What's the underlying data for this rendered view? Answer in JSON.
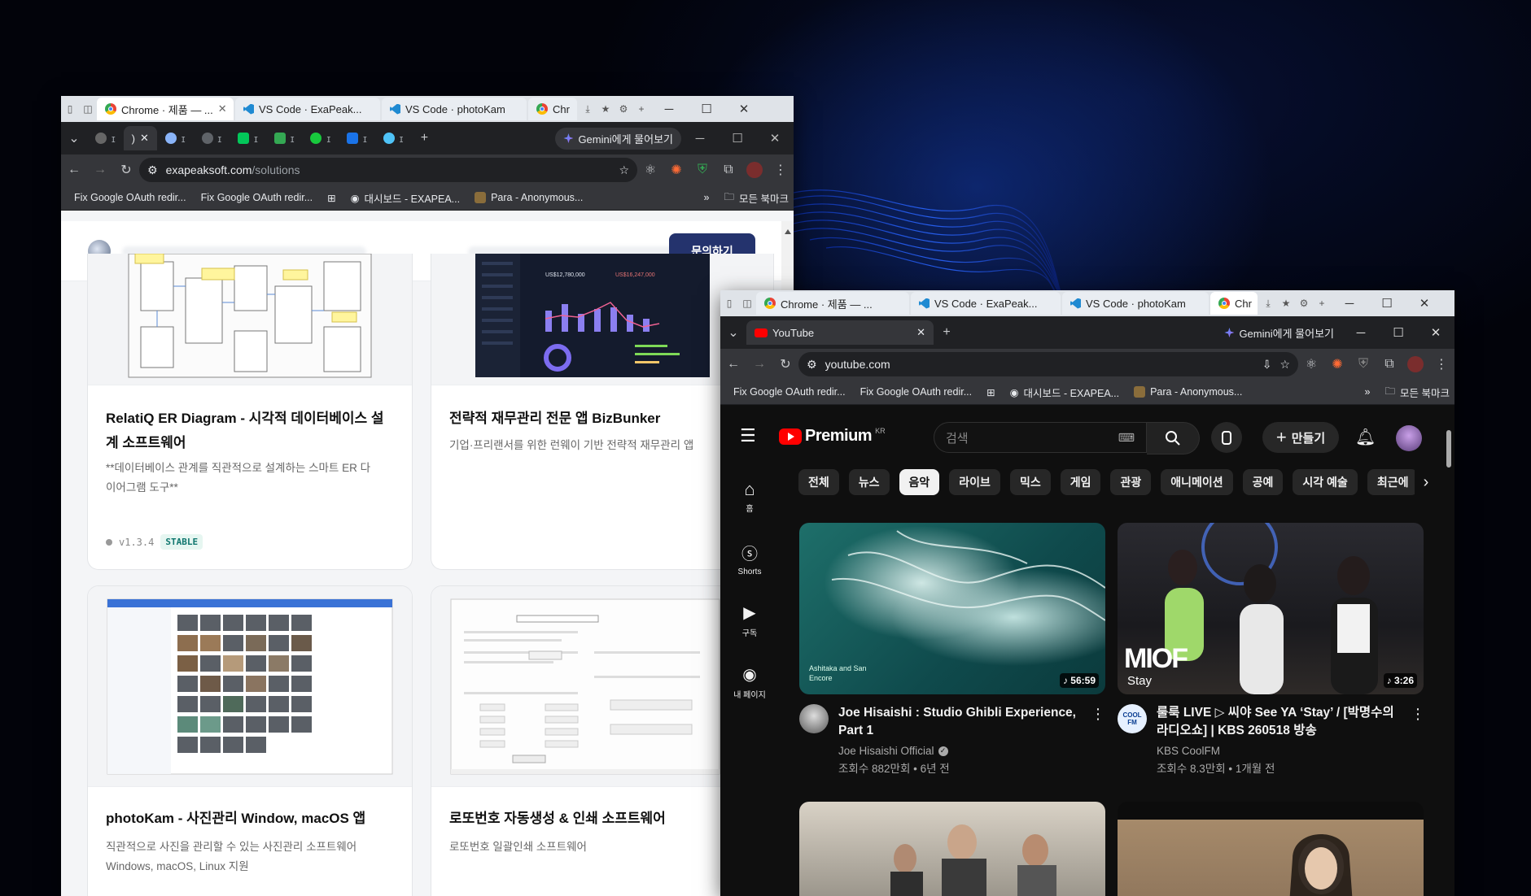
{
  "left_window": {
    "taskbar_tabs": [
      "Chrome · 제품 — ...",
      "VS Code · ExaPeak...",
      "VS Code · photoKam",
      "Chr"
    ],
    "gemini_label": "Gemini에게 물어보기",
    "url_host": "exapeaksoft.com",
    "url_path": "/solutions",
    "bookmarks": [
      "Fix Google OAuth redir...",
      "Fix Google OAuth redir...",
      "대시보드 - EXAPEA...",
      "Para - Anonymous..."
    ],
    "all_bookmarks": "모든 북마크",
    "contact_button": "문의하기",
    "cards": [
      {
        "title": "RelatiQ ER Diagram - 시각적 데이터베이스 설계 소프트웨어",
        "desc": "**데이터베이스 관계를 직관적으로 설계하는 스마트 ER 다이어그램 도구**",
        "version": "v1.3.4",
        "badge": "STABLE"
      },
      {
        "title": "전략적 재무관리 전문 앱 BizBunker",
        "desc": "기업·프리랜서를 위한 런웨이 기반 전략적 재무관리 앱"
      },
      {
        "title": "photoKam - 사진관리 Window, macOS 앱",
        "desc": "직관적으로 사진을 관리할 수 있는 사진관리 소프트웨어",
        "desc2": "Windows, macOS, Linux 지원"
      },
      {
        "title": "로또번호 자동생성 & 인쇄 소프트웨어",
        "desc": "로또번호 일괄인쇄 소프트웨어"
      }
    ],
    "dash_labels": {
      "a": "US$12,780,000",
      "b": "US$16,247,000"
    }
  },
  "right_window": {
    "taskbar_tabs": [
      "Chrome · 제품 — ...",
      "VS Code · ExaPeak...",
      "VS Code · photoKam",
      "Chr"
    ],
    "tab_title": "YouTube",
    "gemini_label": "Gemini에게 물어보기",
    "url": "youtube.com",
    "bookmarks": [
      "Fix Google OAuth redir...",
      "Fix Google OAuth redir...",
      "대시보드 - EXAPEA...",
      "Para - Anonymous..."
    ],
    "all_bookmarks": "모든 북마크",
    "logo_text": "Premium",
    "logo_country": "KR",
    "search_placeholder": "검색",
    "create_label": "만들기",
    "side_nav": [
      "홈",
      "Shorts",
      "구독",
      "내 페이지"
    ],
    "chips": [
      "전체",
      "뉴스",
      "음악",
      "라이브",
      "믹스",
      "게임",
      "관광",
      "애니메이션",
      "공예",
      "시각 예술",
      "최근에"
    ],
    "selected_chip": "음악",
    "videos": [
      {
        "title": "Joe Hisaishi : Studio Ghibli Experience, Part 1",
        "channel": "Joe Hisaishi Official",
        "meta": "조회수 882만회 • 6년 전",
        "duration": "56:59",
        "overlay1": "Ashitaka and San",
        "overlay2": "Encore"
      },
      {
        "title": "룰룩 LIVE ▷ 씨야 See YA ‘Stay’ / [박명수의 라디오쇼] | KBS 260518 방송",
        "channel": "KBS CoolFM",
        "meta": "조회수 8.3만회 • 1개월 전",
        "duration": "3:26",
        "overlay1": "MIOF",
        "overlay2": "Stay",
        "avatar_text": "COOL FM"
      }
    ]
  }
}
